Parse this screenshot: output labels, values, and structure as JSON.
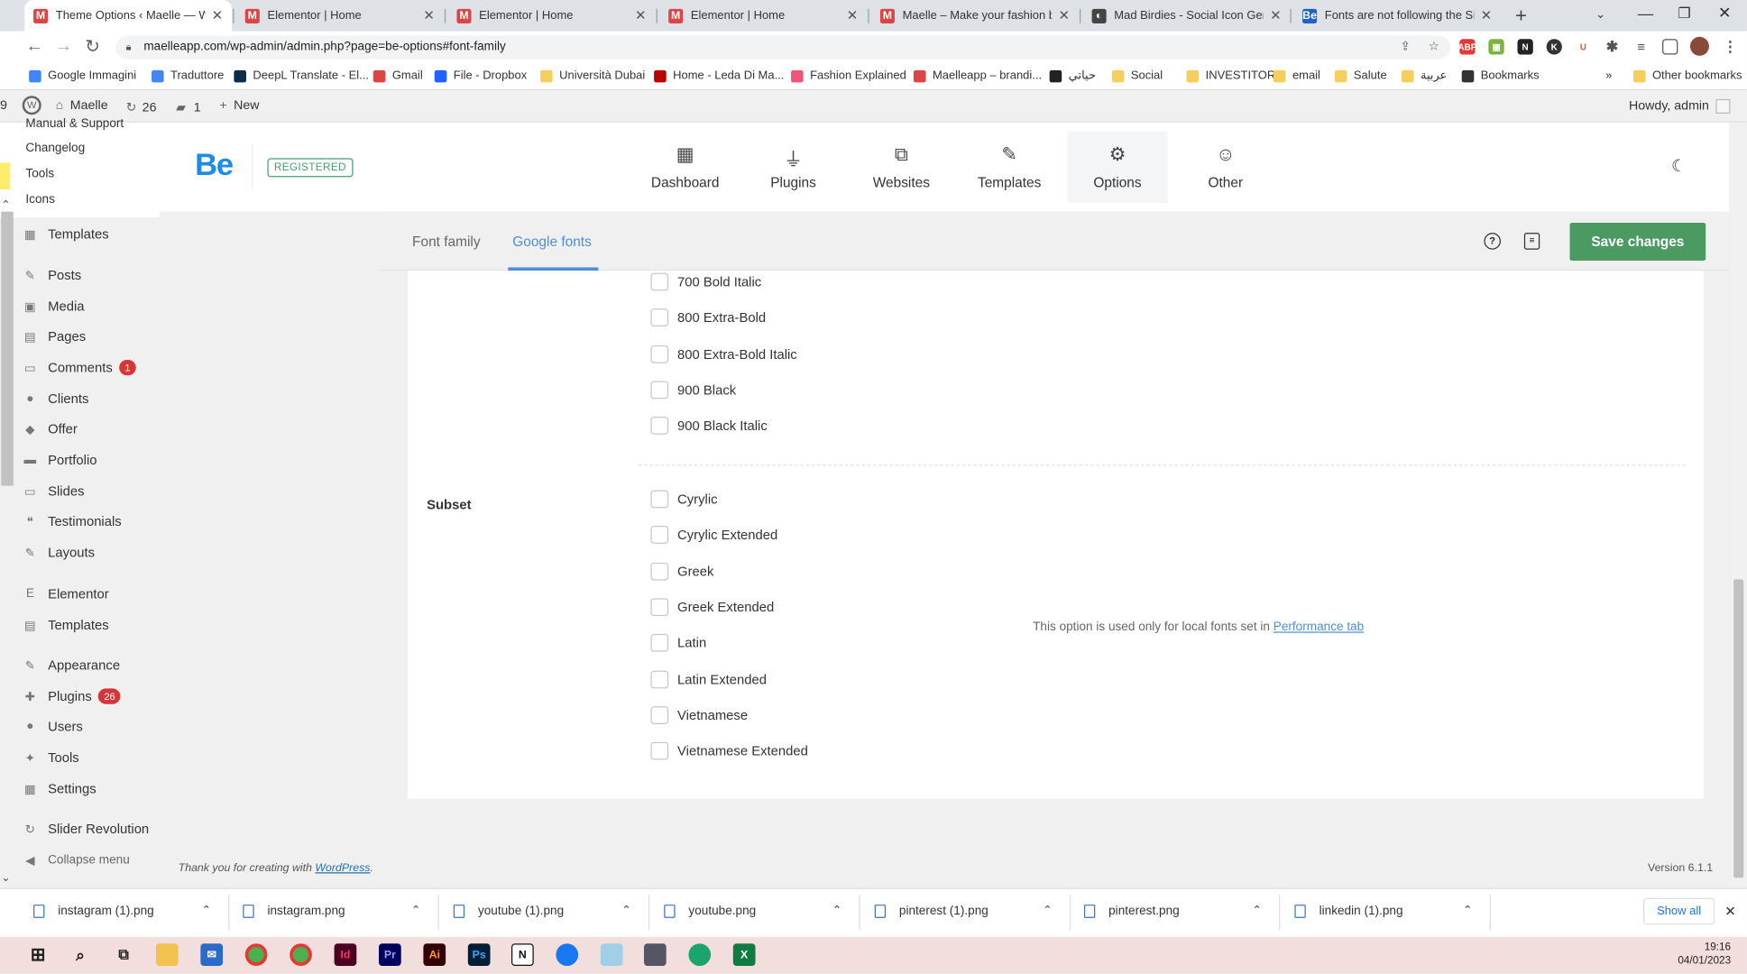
{
  "browser": {
    "tabs": [
      {
        "title": "Theme Options ‹ Maelle — Wor",
        "icon": "M",
        "color": "#d44"
      },
      {
        "title": "Elementor | Home",
        "icon": "M",
        "color": "#d44"
      },
      {
        "title": "Elementor | Home",
        "icon": "M",
        "color": "#d44"
      },
      {
        "title": "Elementor | Home",
        "icon": "M",
        "color": "#d44"
      },
      {
        "title": "Maelle – Make your fashion bra",
        "icon": "M",
        "color": "#d44"
      },
      {
        "title": "Mad Birdies - Social Icon Gener",
        "icon": "◐",
        "color": "#444"
      },
      {
        "title": "Fonts are not following the Site",
        "icon": "Be",
        "color": "#1d62c8"
      }
    ],
    "new_tab": "+",
    "url": "maelleapp.com/wp-admin/admin.php?page=be-options#font-family",
    "bookmarks": [
      "Google Immagini",
      "Traduttore",
      "DeepL Translate - El...",
      "Gmail",
      "File - Dropbox",
      "Università Dubai",
      "Home - Leda Di Ma...",
      "Fashion Explained",
      "Maelleapp – brandi...",
      "حياتي",
      "Social",
      "INVESTITORI",
      "email",
      "Salute",
      "عربية",
      "Bookmarks"
    ],
    "bookmarks_more": "»",
    "other_bookmarks": "Other bookmarks"
  },
  "wpbar": {
    "site": "Maelle",
    "updates": "26",
    "comments": "1",
    "new": "New",
    "howdy": "Howdy, admin",
    "left_num": "9"
  },
  "sidebar": {
    "sub": [
      "Manual & Support",
      "Changelog",
      "Tools",
      "Icons"
    ],
    "items": [
      {
        "label": "Templates",
        "icon": "▦"
      },
      {
        "label": "Posts",
        "icon": "✎"
      },
      {
        "label": "Media",
        "icon": "▣"
      },
      {
        "label": "Pages",
        "icon": "▤"
      },
      {
        "label": "Comments",
        "icon": "▭",
        "badge": "1"
      },
      {
        "label": "Clients",
        "icon": "●"
      },
      {
        "label": "Offer",
        "icon": "◆"
      },
      {
        "label": "Portfolio",
        "icon": "▬"
      },
      {
        "label": "Slides",
        "icon": "▭"
      },
      {
        "label": "Testimonials",
        "icon": "❝"
      },
      {
        "label": "Layouts",
        "icon": "✎"
      },
      {
        "label": "Elementor",
        "icon": "E"
      },
      {
        "label": "Templates",
        "icon": "▤"
      },
      {
        "label": "Appearance",
        "icon": "✎"
      },
      {
        "label": "Plugins",
        "icon": "✚",
        "badge": "26"
      },
      {
        "label": "Users",
        "icon": "●"
      },
      {
        "label": "Tools",
        "icon": "✦"
      },
      {
        "label": "Settings",
        "icon": "▦"
      },
      {
        "label": "Slider Revolution",
        "icon": "↻"
      },
      {
        "label": "Collapse menu",
        "icon": "◀"
      }
    ]
  },
  "be": {
    "logo": "Be",
    "registered": "REGISTERED",
    "nav": [
      {
        "label": "Dashboard",
        "icon": "▦"
      },
      {
        "label": "Plugins",
        "icon": "⏚"
      },
      {
        "label": "Websites",
        "icon": "⧉"
      },
      {
        "label": "Templates",
        "icon": "✎"
      },
      {
        "label": "Options",
        "icon": "⚙"
      },
      {
        "label": "Other",
        "icon": "☺"
      }
    ],
    "moon": "☾",
    "subtabs": [
      "Font family",
      "Google fonts"
    ],
    "help_icon": "?",
    "save": "Save changes"
  },
  "content": {
    "weights": [
      "700 Bold Italic",
      "800 Extra-Bold",
      "800 Extra-Bold Italic",
      "900 Black",
      "900 Black Italic"
    ],
    "subset_label": "Subset",
    "subsets": [
      "Cyrylic",
      "Cyrylic Extended",
      "Greek",
      "Greek Extended",
      "Latin",
      "Latin Extended",
      "Vietnamese",
      "Vietnamese Extended"
    ],
    "note": "This option is used only for local fonts set in",
    "note_link": "Performance tab"
  },
  "footer": {
    "thanks": "Thank you for creating with",
    "wp": "WordPress",
    "dot": ".",
    "version": "Version 6.1.1"
  },
  "downloads": {
    "files": [
      "instagram (1).png",
      "instagram.png",
      "youtube (1).png",
      "youtube.png",
      "pinterest (1).png",
      "pinterest.png",
      "linkedin (1).png"
    ],
    "show_all": "Show all",
    "close": "✕"
  },
  "taskbar": {
    "time": "19:16",
    "date": "04/01/2023"
  }
}
